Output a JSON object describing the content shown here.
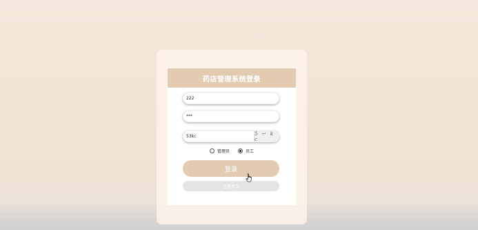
{
  "login_panel": {
    "title": "药店管理系统登录",
    "username_value": "222",
    "password_value": "***",
    "captcha_value": "53kc",
    "captcha_image_text": "5 ↩ k c",
    "roles": [
      {
        "label": "管理员",
        "checked": false
      },
      {
        "label": "员工",
        "checked": true
      }
    ],
    "login_label": "登录",
    "register_label": "注册员工"
  },
  "colors": {
    "accent": "#e2cbb1",
    "background": "#f4e8dc",
    "register_button": "#e4e4e4"
  }
}
